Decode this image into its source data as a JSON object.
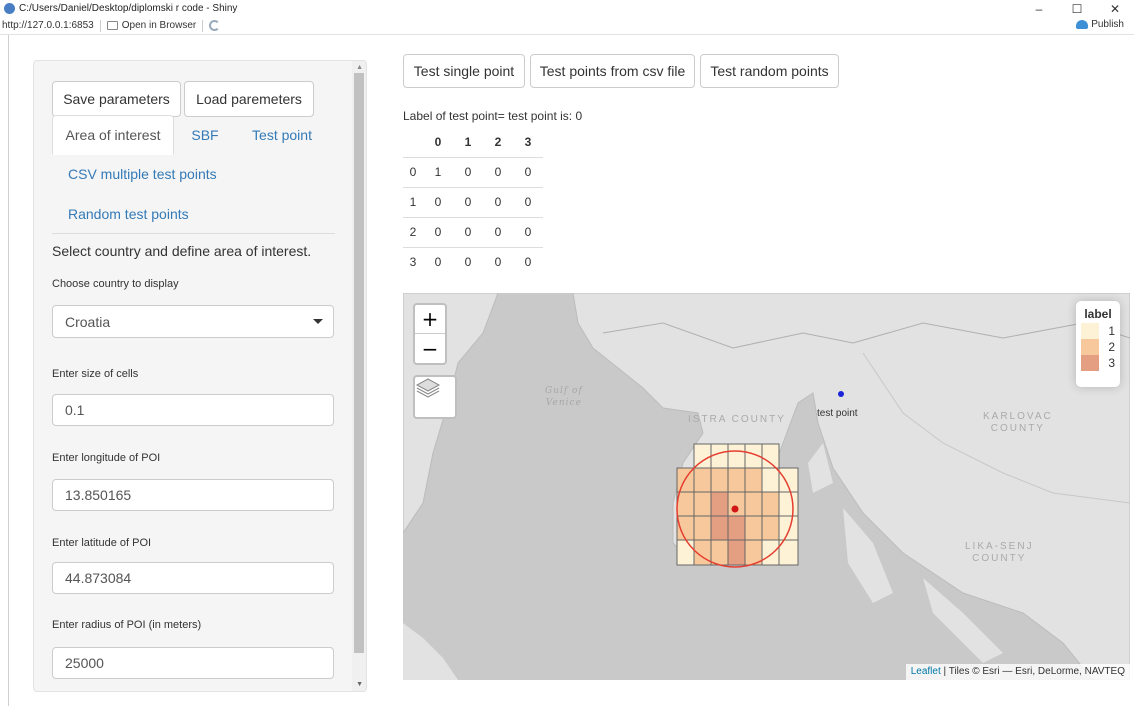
{
  "window": {
    "title": "C:/Users/Daniel/Desktop/diplomski r code - Shiny",
    "minimize": "–",
    "maximize": "☐",
    "close": "✕"
  },
  "toolbar": {
    "url": "http://127.0.0.1:6853",
    "open_in_browser": "Open in Browser",
    "publish": "Publish"
  },
  "sidebar": {
    "save_label": "Save parameters",
    "load_label": "Load paremeters",
    "tabs": [
      {
        "label": "Area of interest"
      },
      {
        "label": "SBF"
      },
      {
        "label": "Test point"
      }
    ],
    "pills": [
      {
        "label": "CSV multiple test points"
      },
      {
        "label": "Random test points"
      }
    ],
    "description": "Select country and define area of interest.",
    "country": {
      "label": "Choose country to display",
      "value": "Croatia"
    },
    "cell_size": {
      "label": "Enter size of cells",
      "value": "0.1"
    },
    "longitude": {
      "label": "Enter longitude of POI",
      "value": "13.850165"
    },
    "latitude": {
      "label": "Enter latitude of POI",
      "value": "44.873084"
    },
    "radius": {
      "label": "Enter radius of POI (in meters)",
      "value": "25000"
    }
  },
  "main": {
    "buttons": [
      {
        "label": "Test single point"
      },
      {
        "label": "Test points from csv file"
      },
      {
        "label": "Test random points"
      }
    ],
    "result_label": "Label of test point= test point is: 0",
    "table": {
      "header": [
        "",
        "0",
        "1",
        "2",
        "3"
      ],
      "rows": [
        [
          "0",
          "1",
          "0",
          "0",
          "0"
        ],
        [
          "1",
          "0",
          "0",
          "0",
          "0"
        ],
        [
          "2",
          "0",
          "0",
          "0",
          "0"
        ],
        [
          "3",
          "0",
          "0",
          "0",
          "0"
        ]
      ]
    }
  },
  "map": {
    "zoom_in": "+",
    "zoom_out": "−",
    "legend": {
      "title": "label",
      "items": [
        {
          "label": "1",
          "color": "#fdf1d6"
        },
        {
          "label": "2",
          "color": "#f6c89c"
        },
        {
          "label": "3",
          "color": "#e49f82"
        }
      ]
    },
    "sea_label": [
      "Gulf of",
      "Venice"
    ],
    "regions": {
      "istra": "ISTRA COUNTY",
      "karlovac": [
        "KARLOVAC",
        "COUNTY"
      ],
      "lika": [
        "LIKA-SENJ",
        "COUNTY"
      ]
    },
    "test_point_label": "test point",
    "attribution": {
      "leaflet": "Leaflet",
      "rest": " | Tiles © Esri — Esri, DeLorme, NAVTEQ"
    },
    "colors": {
      "circle": "#e53d2f",
      "poi_marker": "#d11414",
      "test_point_marker": "#1a24d8"
    }
  }
}
